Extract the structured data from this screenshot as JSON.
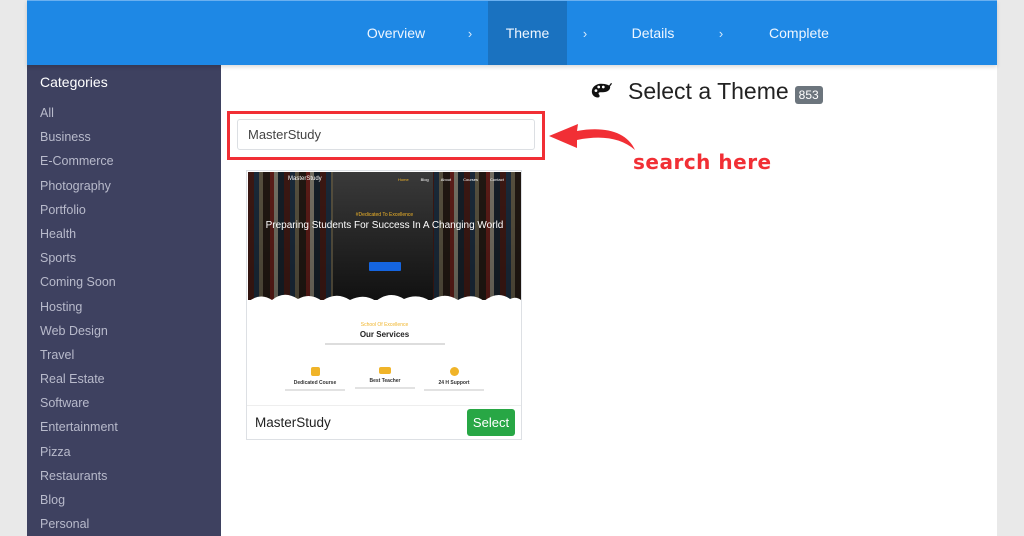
{
  "wizard": {
    "steps": [
      {
        "label": "Overview",
        "active": false
      },
      {
        "label": "Theme",
        "active": true
      },
      {
        "label": "Details",
        "active": false
      },
      {
        "label": "Complete",
        "active": false
      }
    ],
    "separator": "›",
    "accent_color": "#1e88e5",
    "active_color": "#1a72c0"
  },
  "sidebar": {
    "title": "Categories",
    "items": [
      {
        "label": "All"
      },
      {
        "label": "Business"
      },
      {
        "label": "E-Commerce"
      },
      {
        "label": "Photography"
      },
      {
        "label": "Portfolio"
      },
      {
        "label": "Health"
      },
      {
        "label": "Sports"
      },
      {
        "label": "Coming Soon"
      },
      {
        "label": "Hosting"
      },
      {
        "label": "Web Design"
      },
      {
        "label": "Travel"
      },
      {
        "label": "Real Estate"
      },
      {
        "label": "Software"
      },
      {
        "label": "Entertainment"
      },
      {
        "label": "Pizza"
      },
      {
        "label": "Restaurants"
      },
      {
        "label": "Blog"
      },
      {
        "label": "Personal"
      }
    ]
  },
  "main": {
    "heading_icon": "palette-icon",
    "heading": "Select a Theme",
    "theme_count": "853",
    "search": {
      "value": "MasterStudy",
      "placeholder": ""
    },
    "annotation": {
      "text": "search here",
      "color": "#f12f35"
    },
    "themes": [
      {
        "name": "MasterStudy",
        "select_label": "Select",
        "preview": {
          "logo": "MasterStudy",
          "nav": [
            "Home",
            "Blog",
            "About",
            "Courses",
            "Contact"
          ],
          "tagline": "#Dedicated To Excellence",
          "headline": "Preparing Students For Success In A Changing World",
          "section_kicker": "School Of Excellence",
          "section_title": "Our Services",
          "features": [
            "Dedicated Course",
            "Best Teacher",
            "24 H Support"
          ]
        }
      }
    ]
  }
}
